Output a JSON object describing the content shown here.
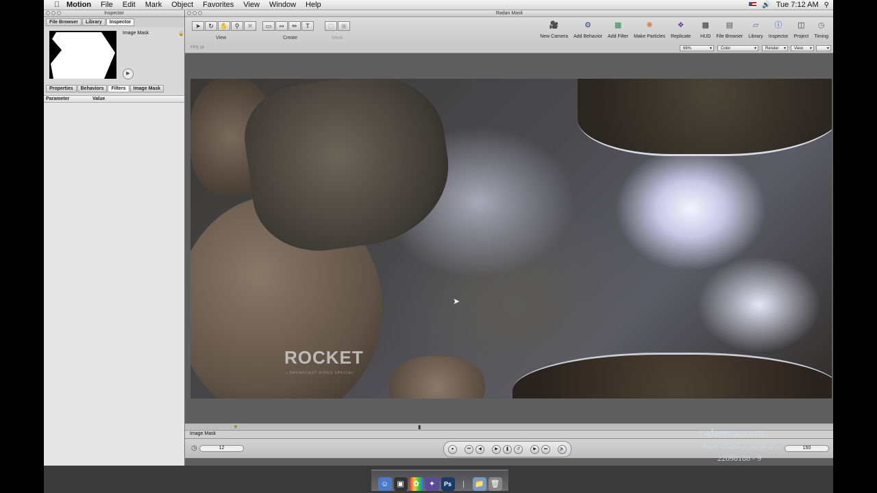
{
  "menubar": {
    "apple": "",
    "app": "Motion",
    "items": [
      "File",
      "Edit",
      "Mark",
      "Object",
      "Favorites",
      "View",
      "Window",
      "Help"
    ],
    "clock": "Tue 7:12 AM"
  },
  "inspector": {
    "window_title": "Inspector",
    "tabs": [
      "File Browser",
      "Library",
      "Inspector"
    ],
    "preview_title": "Image Mask",
    "sub_tabs": [
      "Properties",
      "Behaviors",
      "Filters",
      "Image Mask"
    ],
    "param_header": "Parameter",
    "value_header": "Value"
  },
  "canvas": {
    "window_title": "Radan Mask",
    "group_view": "View",
    "group_create": "Create",
    "group_mask": "Mask",
    "tools": [
      "New Camera",
      "Add Behavior",
      "Add Filter",
      "Make Particles",
      "Replicate",
      "HUD",
      "File Browser",
      "Library",
      "Inspector",
      "Project",
      "Timing"
    ],
    "fps_label": "FPS",
    "fps_value": "19",
    "zoom": "66%",
    "channel": "Color",
    "render": "Render",
    "view": "View"
  },
  "watermarks": {
    "rocket": "ROCKET",
    "rocket_sub": "• BROADCAST VIDEO SPECIAL",
    "radan_url": "radanmac.com",
    "radan_sub": "Apple مرکز فروش و خدمات",
    "radan_phone": "22098188 - 9"
  },
  "timeline": {
    "track_name": "Image Mask",
    "current_frame": "12",
    "end_frame": "150"
  },
  "colors": {
    "accent": "#3b5998"
  }
}
